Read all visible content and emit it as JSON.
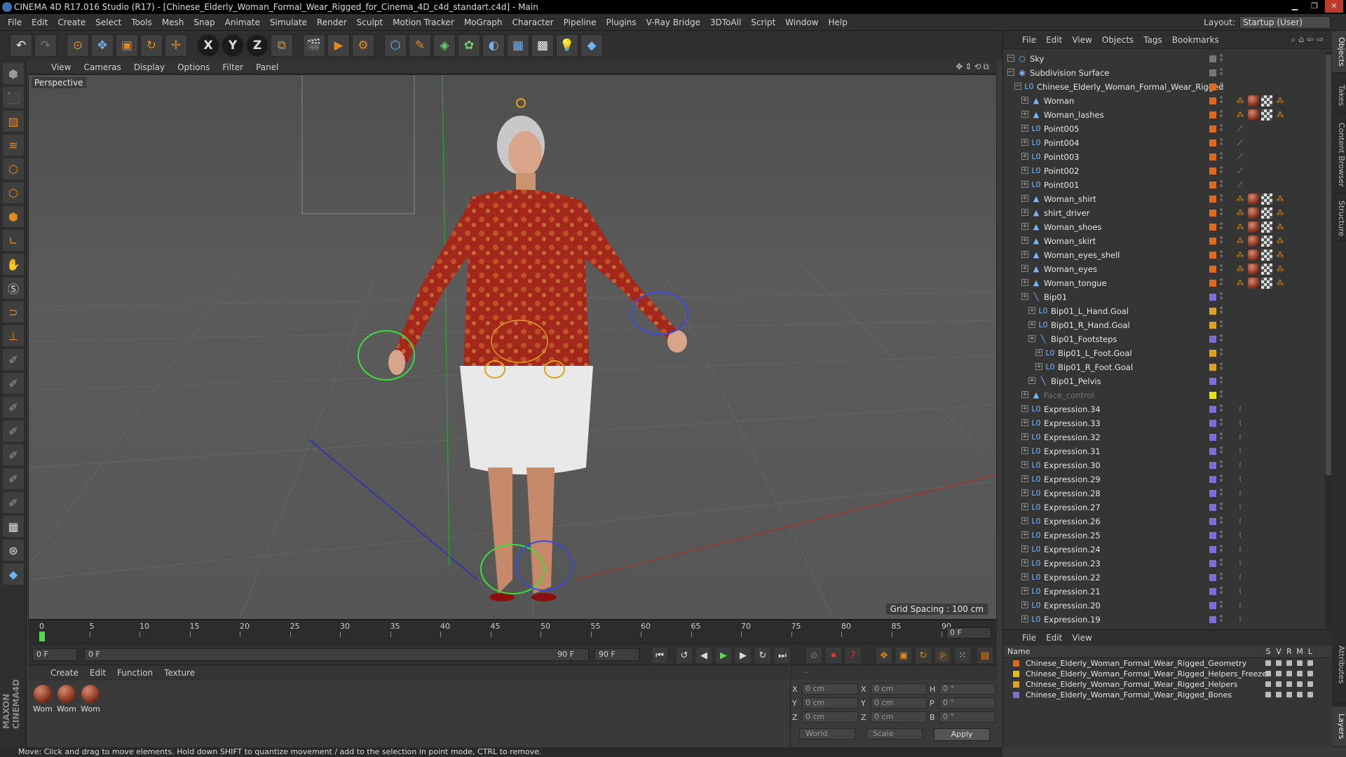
{
  "window": {
    "title": "CINEMA 4D R17.016 Studio (R17) - [Chinese_Elderly_Woman_Formal_Wear_Rigged_for_Cinema_4D_c4d_standart.c4d] - Main"
  },
  "menus": [
    "File",
    "Edit",
    "Create",
    "Select",
    "Tools",
    "Mesh",
    "Snap",
    "Animate",
    "Simulate",
    "Render",
    "Sculpt",
    "Motion Tracker",
    "MoGraph",
    "Character",
    "Pipeline",
    "Plugins",
    "V-Ray Bridge",
    "3DToAll",
    "Script",
    "Window",
    "Help"
  ],
  "layout": {
    "label": "Layout:",
    "value": "Startup (User)"
  },
  "viewport": {
    "menus": [
      "View",
      "Cameras",
      "Display",
      "Options",
      "Filter",
      "Panel"
    ],
    "camera_label": "Perspective",
    "grid_spacing": "Grid Spacing : 100 cm"
  },
  "timeline": {
    "ticks": [
      "0",
      "5",
      "10",
      "15",
      "20",
      "25",
      "30",
      "35",
      "40",
      "45",
      "50",
      "55",
      "60",
      "65",
      "70",
      "75",
      "80",
      "85",
      "90"
    ],
    "current_frame": "0 F",
    "start_field": "0 F",
    "range_start": "0 F",
    "range_end": "90 F",
    "end_field": "90 F",
    "frame_readout": "0 F"
  },
  "materials": {
    "menus": [
      "Create",
      "Edit",
      "Function",
      "Texture"
    ],
    "items": [
      "Wom",
      "Wom",
      "Wom"
    ]
  },
  "coords": {
    "header": "--",
    "rows": [
      {
        "a": "X",
        "av": "0 cm",
        "b": "X",
        "bv": "0 cm",
        "c": "H",
        "cv": "0 °"
      },
      {
        "a": "Y",
        "av": "0 cm",
        "b": "Y",
        "bv": "0 cm",
        "c": "P",
        "cv": "0 °"
      },
      {
        "a": "Z",
        "av": "0 cm",
        "b": "Z",
        "bv": "0 cm",
        "c": "B",
        "cv": "0 °"
      }
    ],
    "space": "World",
    "mode": "Scale",
    "apply": "Apply"
  },
  "status": "Move: Click and drag to move elements. Hold down SHIFT to quantize movement / add to the selection in point mode, CTRL to remove.",
  "objects_panel": {
    "menus": [
      "File",
      "Edit",
      "View",
      "Objects",
      "Tags",
      "Bookmarks"
    ]
  },
  "objects": [
    {
      "name": "Sky",
      "indent": 0,
      "icon": "○",
      "layer": ""
    },
    {
      "name": "Subdivision Surface",
      "indent": 0,
      "icon": "◉",
      "layer": ""
    },
    {
      "name": "Chinese_Elderly_Woman_Formal_Wear_Rigged",
      "indent": 1,
      "icon": "L0",
      "layer": "#e06a1a"
    },
    {
      "name": "Woman",
      "indent": 2,
      "icon": "▲",
      "layer": "#e06a1a",
      "tags": "jmcj"
    },
    {
      "name": "Woman_lashes",
      "indent": 2,
      "icon": "▲",
      "layer": "#e06a1a",
      "tags": "jmcj"
    },
    {
      "name": "Point005",
      "indent": 2,
      "icon": "L0",
      "layer": "#e06a1a",
      "tags": "b"
    },
    {
      "name": "Point004",
      "indent": 2,
      "icon": "L0",
      "layer": "#e06a1a",
      "tags": "b"
    },
    {
      "name": "Point003",
      "indent": 2,
      "icon": "L0",
      "layer": "#e06a1a",
      "tags": "b"
    },
    {
      "name": "Point002",
      "indent": 2,
      "icon": "L0",
      "layer": "#e06a1a",
      "tags": "b"
    },
    {
      "name": "Point001",
      "indent": 2,
      "icon": "L0",
      "layer": "#e06a1a",
      "tags": "b"
    },
    {
      "name": "Woman_shirt",
      "indent": 2,
      "icon": "▲",
      "layer": "#e06a1a",
      "tags": "jmcj"
    },
    {
      "name": "shirt_driver",
      "indent": 2,
      "icon": "▲",
      "layer": "#e06a1a",
      "tags": "jmcj"
    },
    {
      "name": "Woman_shoes",
      "indent": 2,
      "icon": "▲",
      "layer": "#e06a1a",
      "tags": "jmcj"
    },
    {
      "name": "Woman_skirt",
      "indent": 2,
      "icon": "▲",
      "layer": "#e06a1a",
      "tags": "jmcj"
    },
    {
      "name": "Woman_eyes_shell",
      "indent": 2,
      "icon": "▲",
      "layer": "#e06a1a",
      "tags": "jmcj"
    },
    {
      "name": "Woman_eyes",
      "indent": 2,
      "icon": "▲",
      "layer": "#e06a1a",
      "tags": "jmcj"
    },
    {
      "name": "Woman_tongue",
      "indent": 2,
      "icon": "▲",
      "layer": "#e06a1a",
      "tags": "jmcj"
    },
    {
      "name": "Bip01",
      "indent": 2,
      "icon": "╲",
      "layer": "#7a6fd8"
    },
    {
      "name": "Bip01_L_Hand.Goal",
      "indent": 3,
      "icon": "L0",
      "layer": "#e0a020"
    },
    {
      "name": "Bip01_R_Hand.Goal",
      "indent": 3,
      "icon": "L0",
      "layer": "#e0a020"
    },
    {
      "name": "Bip01_Footsteps",
      "indent": 3,
      "icon": "╲",
      "layer": "#7a6fd8"
    },
    {
      "name": "Bip01_L_Foot.Goal",
      "indent": 4,
      "icon": "L0",
      "layer": "#e0a020"
    },
    {
      "name": "Bip01_R_Foot.Goal",
      "indent": 4,
      "icon": "L0",
      "layer": "#e0a020"
    },
    {
      "name": "Bip01_Pelvis",
      "indent": 3,
      "icon": "╲",
      "layer": "#7a6fd8"
    },
    {
      "name": "Face_control",
      "indent": 2,
      "icon": "▲",
      "layer": "#e6e600",
      "dim": true
    },
    {
      "name": "Expression.34",
      "indent": 2,
      "icon": "L0",
      "layer": "#7a6fd8",
      "tags": "x"
    },
    {
      "name": "Expression.33",
      "indent": 2,
      "icon": "L0",
      "layer": "#7a6fd8",
      "tags": "x"
    },
    {
      "name": "Expression.32",
      "indent": 2,
      "icon": "L0",
      "layer": "#7a6fd8",
      "tags": "x"
    },
    {
      "name": "Expression.31",
      "indent": 2,
      "icon": "L0",
      "layer": "#7a6fd8",
      "tags": "x"
    },
    {
      "name": "Expression.30",
      "indent": 2,
      "icon": "L0",
      "layer": "#7a6fd8",
      "tags": "x"
    },
    {
      "name": "Expression.29",
      "indent": 2,
      "icon": "L0",
      "layer": "#7a6fd8",
      "tags": "x"
    },
    {
      "name": "Expression.28",
      "indent": 2,
      "icon": "L0",
      "layer": "#7a6fd8",
      "tags": "x"
    },
    {
      "name": "Expression.27",
      "indent": 2,
      "icon": "L0",
      "layer": "#7a6fd8",
      "tags": "x"
    },
    {
      "name": "Expression.26",
      "indent": 2,
      "icon": "L0",
      "layer": "#7a6fd8",
      "tags": "x"
    },
    {
      "name": "Expression.25",
      "indent": 2,
      "icon": "L0",
      "layer": "#7a6fd8",
      "tags": "x"
    },
    {
      "name": "Expression.24",
      "indent": 2,
      "icon": "L0",
      "layer": "#7a6fd8",
      "tags": "x"
    },
    {
      "name": "Expression.23",
      "indent": 2,
      "icon": "L0",
      "layer": "#7a6fd8",
      "tags": "x"
    },
    {
      "name": "Expression.22",
      "indent": 2,
      "icon": "L0",
      "layer": "#7a6fd8",
      "tags": "x"
    },
    {
      "name": "Expression.21",
      "indent": 2,
      "icon": "L0",
      "layer": "#7a6fd8",
      "tags": "x"
    },
    {
      "name": "Expression.20",
      "indent": 2,
      "icon": "L0",
      "layer": "#7a6fd8",
      "tags": "x"
    },
    {
      "name": "Expression.19",
      "indent": 2,
      "icon": "L0",
      "layer": "#7a6fd8",
      "tags": "x"
    }
  ],
  "layers_panel": {
    "menus": [
      "File",
      "Edit",
      "View"
    ],
    "col_name": "Name",
    "flags": [
      "S",
      "V",
      "R",
      "M",
      "L"
    ],
    "layers": [
      {
        "name": "Chinese_Elderly_Woman_Formal_Wear_Rigged_Geometry",
        "color": "#e06a1a"
      },
      {
        "name": "Chinese_Elderly_Woman_Formal_Wear_Rigged_Helpers_Freeze",
        "color": "#e6c000"
      },
      {
        "name": "Chinese_Elderly_Woman_Formal_Wear_Rigged_Helpers",
        "color": "#e0a020"
      },
      {
        "name": "Chinese_Elderly_Woman_Formal_Wear_Rigged_Bones",
        "color": "#7a6fd8"
      }
    ]
  },
  "side_tabs": [
    "Objects",
    "Takes",
    "Content Browser",
    "Structure",
    "Attributes",
    "Layers"
  ]
}
